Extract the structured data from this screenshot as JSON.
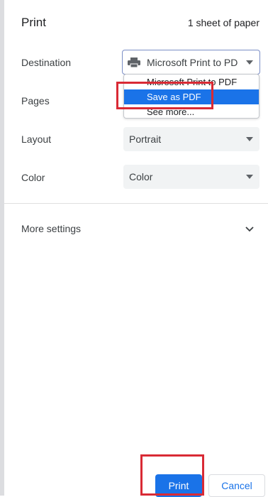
{
  "header": {
    "title": "Print",
    "sheets": "1 sheet of paper"
  },
  "destination": {
    "label": "Destination",
    "selected": "Microsoft Print to PD",
    "icon": "printer-icon",
    "options": [
      "Microsoft Print to PDF",
      "Save as PDF",
      "See more..."
    ],
    "highlighted_option": "Save as PDF"
  },
  "pages": {
    "label": "Pages"
  },
  "layout": {
    "label": "Layout",
    "value": "Portrait"
  },
  "color": {
    "label": "Color",
    "value": "Color"
  },
  "more_settings": {
    "label": "More settings",
    "icon": "chevron-down-icon"
  },
  "buttons": {
    "print": "Print",
    "cancel": "Cancel"
  },
  "colors": {
    "accent": "#1a73e8",
    "highlight_box": "#d92a35",
    "field_bg": "#f1f3f4"
  }
}
